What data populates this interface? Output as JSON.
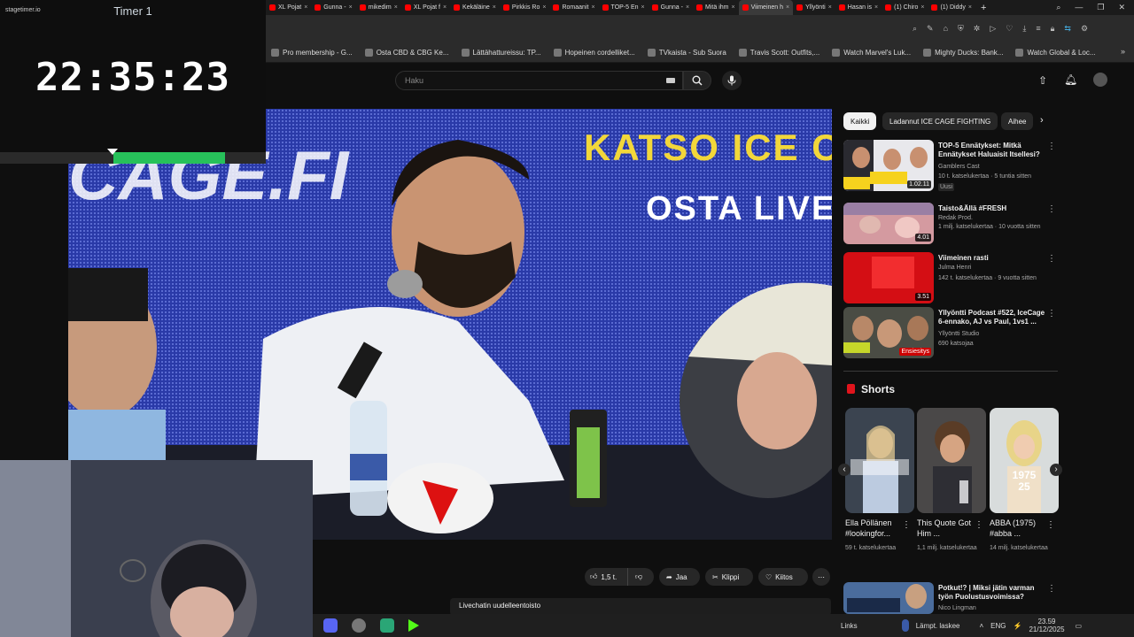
{
  "timer": {
    "logo": "stagetimer.io",
    "title": "Timer 1",
    "clock": "22:35:23",
    "progress_fraction": 0.58
  },
  "browser": {
    "tabs": [
      {
        "label": "XL Pojat",
        "active": false
      },
      {
        "label": "Gunna -",
        "active": false
      },
      {
        "label": "mikedim",
        "active": false
      },
      {
        "label": "XL Pojat f",
        "active": false
      },
      {
        "label": "Kekäläine",
        "active": false
      },
      {
        "label": "Pirkkis Ro",
        "active": false
      },
      {
        "label": "Romaanit",
        "active": false
      },
      {
        "label": "TOP-5 En",
        "active": false
      },
      {
        "label": "Gunna -",
        "active": false
      },
      {
        "label": "Mitä ihm",
        "active": false
      },
      {
        "label": "Viimeinen h",
        "active": true
      },
      {
        "label": "Yllyönti",
        "active": false
      },
      {
        "label": "Hasan is",
        "active": false
      },
      {
        "label": "(1) Chiro",
        "active": false
      },
      {
        "label": "(1) Diddy",
        "active": false
      }
    ],
    "bookmarks": [
      "Pro membership - G...",
      "Osta CBD & CBG Ke...",
      "Lättähattureissu: TP...",
      "Hopeinen cordelliket...",
      "TVkaista - Sub Suora",
      "Travis Scott: Outfits,...",
      "Watch Marvel's Luk...",
      "Mighty Ducks: Bank...",
      "Watch Global & Loc..."
    ]
  },
  "youtube": {
    "search_placeholder": "Haku",
    "chips": [
      "Kaikki",
      "Ladannut ICE CAGE FIGHTING",
      "Aihee"
    ],
    "recommendations": [
      {
        "title": "TOP-5 Ennätykset: Mitkä Ennätykset Haluaisit Itsellesi?",
        "channel": "Gamblers Cast",
        "stats": "10 t. katselukertaa · 5 tuntia sitten",
        "badge": "Uusi",
        "duration": "1.02.11"
      },
      {
        "title": "Taisto&Ällä #FRESH",
        "channel": "Redak Prod.",
        "stats": "1 milj. katselukertaa · 10 vuotta sitten",
        "badge": "",
        "duration": "4.01"
      },
      {
        "title": "Viimeinen rasti",
        "channel": "Julma Henri",
        "stats": "142 t. katselukertaa · 9 vuotta sitten",
        "badge": "",
        "duration": "3.51"
      },
      {
        "title": "Yllyöntti Podcast #522, IceCage 6-ennako, AJ vs Paul, 1vs1 ...",
        "channel": "Yllyöntti Studio",
        "stats": "690 katsojaa",
        "badge": "",
        "duration": "Ensiesitys"
      }
    ],
    "shorts_heading": "Shorts",
    "shorts": [
      {
        "title": "Ella Pöllänen #lookingfor...",
        "views": "59 t. katselukertaa"
      },
      {
        "title": "This Quote Got Him ...",
        "views": "1,1 milj. katselukertaa"
      },
      {
        "title": "ABBA (1975) #abba ...",
        "views": "14 milj. katselukertaa"
      }
    ],
    "next_video": {
      "title": "Potkut!? | Miksi jätin varman työn Puolustusvoimissa?",
      "channel": "Nico Lingman"
    },
    "video_banner": "KATSO ICE CA",
    "video_banner2": "OSTA LIVE",
    "video_banner3": "CAGE.FI",
    "actions": {
      "likes": "1,5 t.",
      "share": "Jaa",
      "clip": "Klippi",
      "thanks": "Kiitos"
    },
    "chat_replay": "Livechatin uudelleentoisto"
  },
  "taskbar": {
    "links": "Links",
    "weather": "Lämpt. laskee",
    "lang": "ENG",
    "time": "23.59",
    "date": "21/12/2025"
  }
}
